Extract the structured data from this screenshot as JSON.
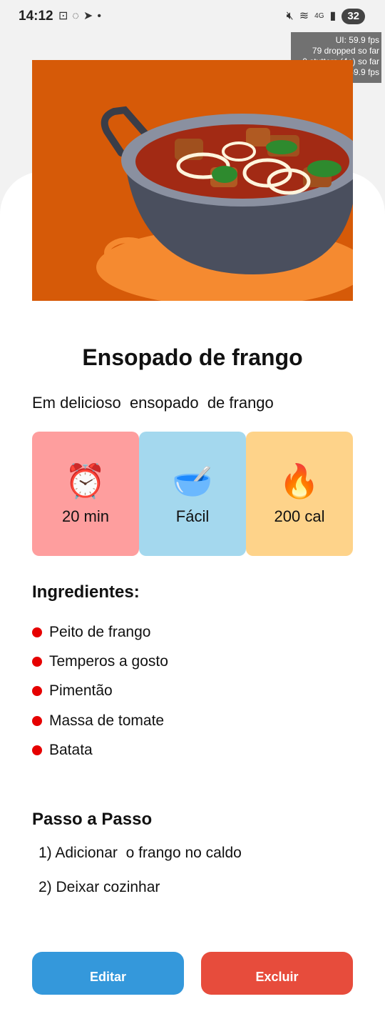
{
  "status_bar": {
    "time": "14:12",
    "battery": "32",
    "network": "4G"
  },
  "perf_overlay": {
    "ui_fps": "UI: 59.9 fps",
    "dropped": "79 dropped so far",
    "stutters": "0 stutters (4+) so far",
    "js_fps": "JS: 59.9 fps"
  },
  "recipe": {
    "title": "Ensopado de frango",
    "description": "Em delicioso  ensopado  de frango",
    "info": [
      {
        "emoji": "⏰",
        "value": "20 min",
        "color": "#fe9e9e"
      },
      {
        "emoji": "🥣",
        "value": "Fácil",
        "color": "#a4d8ee"
      },
      {
        "emoji": "🔥",
        "value": "200 cal",
        "color": "#fed38a"
      }
    ],
    "ingredients_heading": "Ingredientes:",
    "ingredients": [
      "Peito de frango",
      "Temperos a gosto",
      "Pimentão",
      "Massa de tomate",
      "Batata"
    ],
    "steps_heading": "Passo a Passo",
    "steps": [
      "1) Adicionar  o frango no caldo",
      "2) Deixar cozinhar"
    ]
  },
  "actions": {
    "edit_label": "Editar",
    "edit_color": "#3498db",
    "delete_label": "Excluir",
    "delete_color": "#e74c3c"
  }
}
